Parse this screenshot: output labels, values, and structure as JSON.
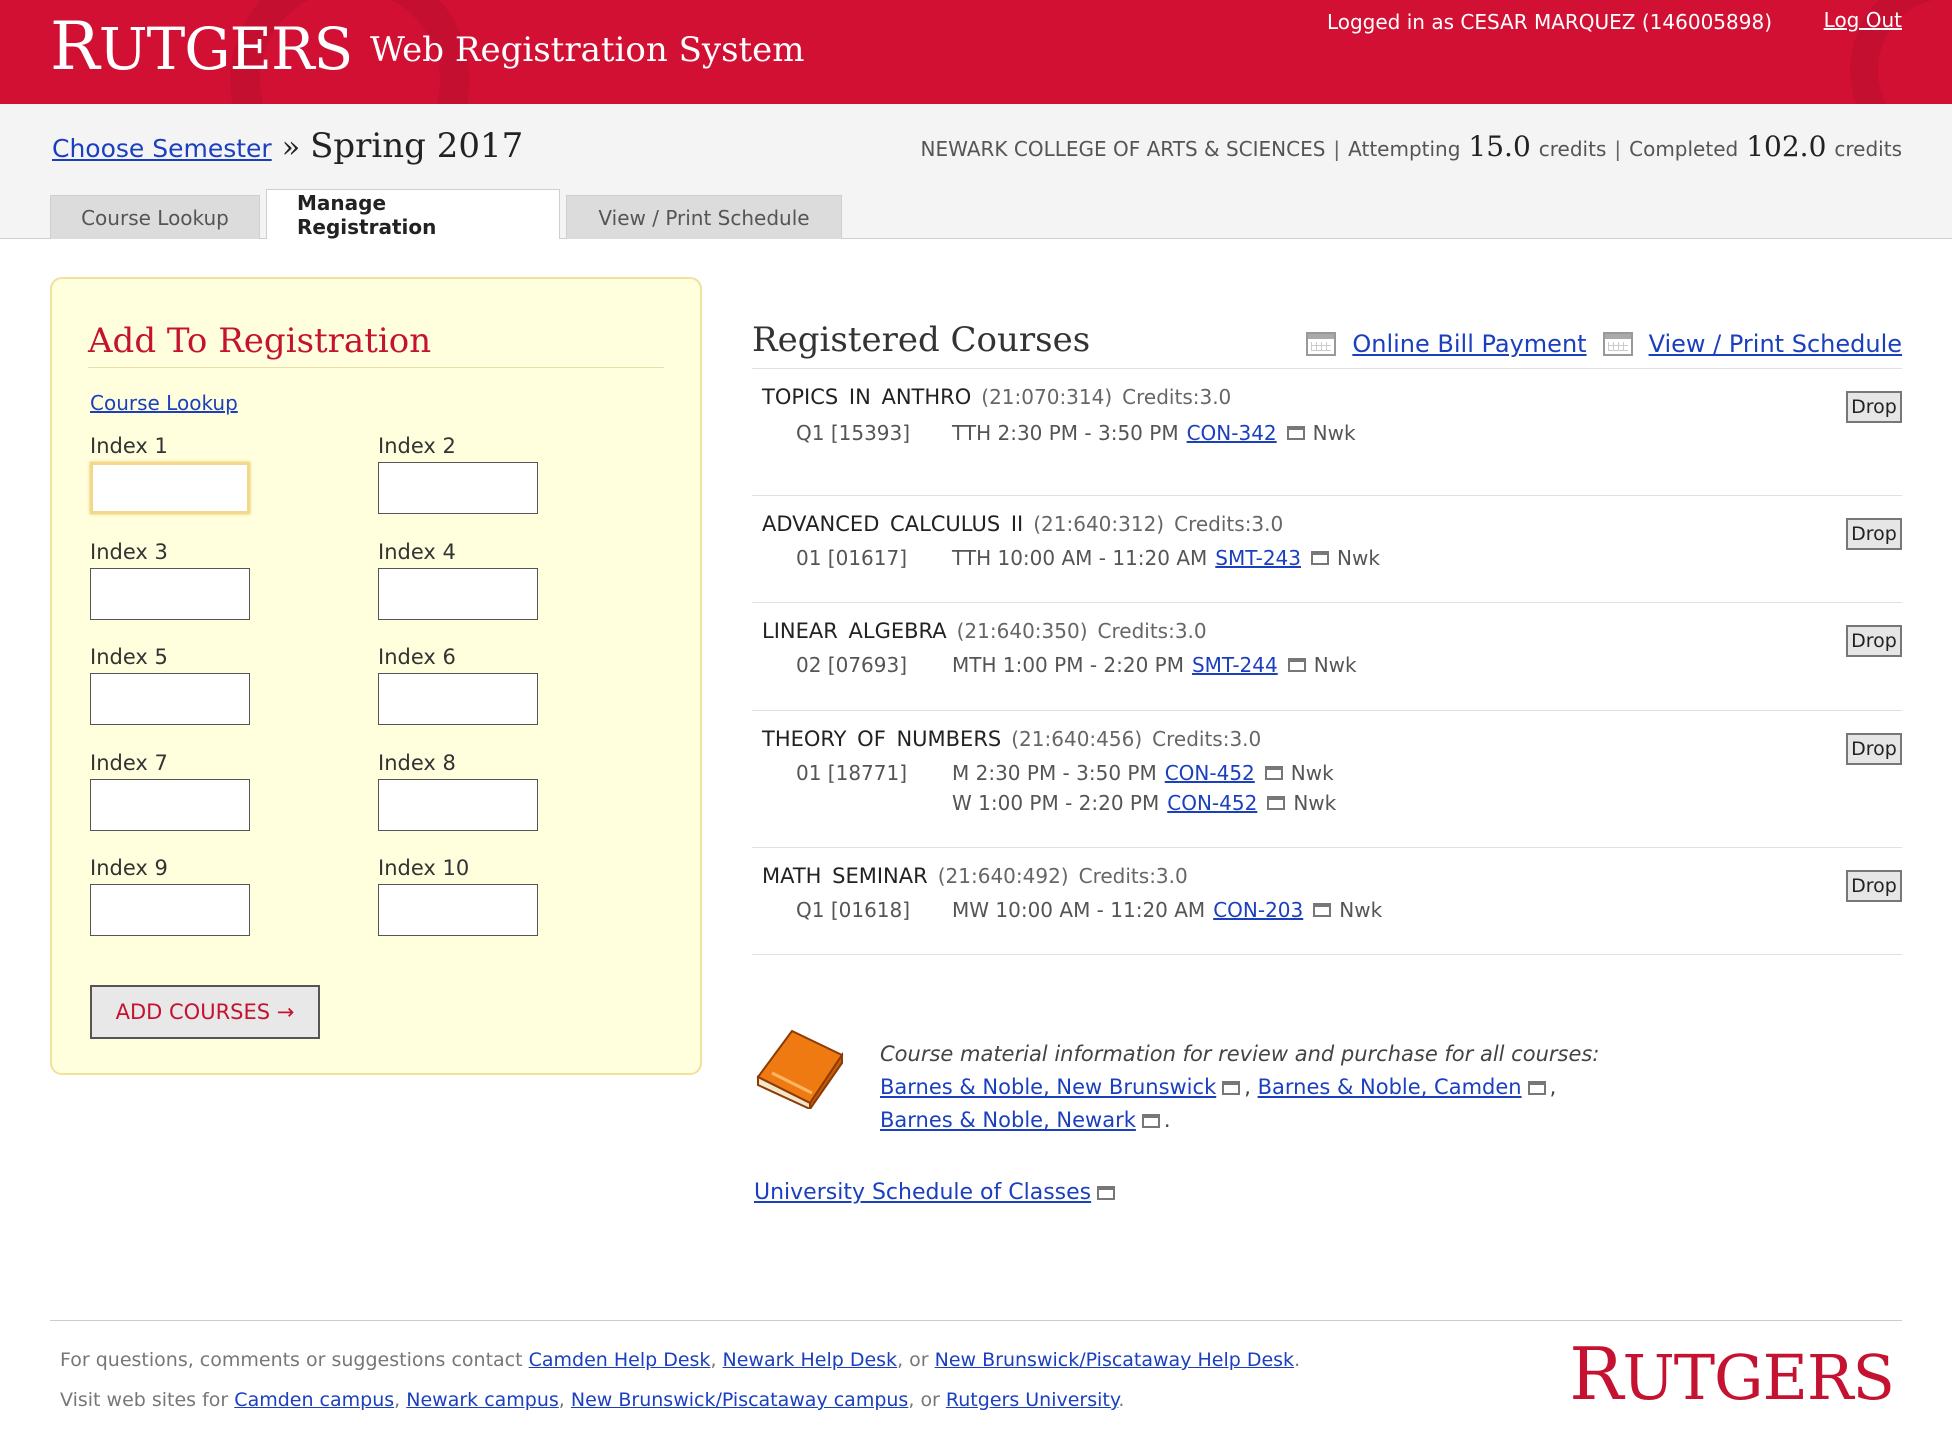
{
  "header": {
    "logo_first": "R",
    "logo_rest": "UTGERS",
    "app_title": "Web Registration System",
    "user_text": "Logged in as CESAR MARQUEZ (146005898)",
    "logout_label": "Log Out"
  },
  "subheader": {
    "choose_semester": "Choose Semester",
    "separator": "»",
    "semester": "Spring 2017",
    "college": "NEWARK COLLEGE OF ARTS & SCIENCES",
    "attempting_label": "Attempting",
    "attempting_value": "15.0",
    "completed_label": "Completed",
    "completed_value": "102.0",
    "credits_word": "credits",
    "pipe": "|"
  },
  "tabs": [
    {
      "label": "Course Lookup",
      "active": false
    },
    {
      "label": "Manage Registration",
      "active": true
    },
    {
      "label": "View / Print Schedule",
      "active": false
    }
  ],
  "add_panel": {
    "title": "Add To Registration",
    "lookup_link": "Course Lookup",
    "index_labels": [
      "Index 1",
      "Index 2",
      "Index 3",
      "Index 4",
      "Index 5",
      "Index 6",
      "Index 7",
      "Index 8",
      "Index 9",
      "Index 10"
    ],
    "index_values": [
      "",
      "",
      "",
      "",
      "",
      "",
      "",
      "",
      "",
      ""
    ],
    "button_label": "ADD COURSES →"
  },
  "registered": {
    "title": "Registered Courses",
    "bill_link": "Online Bill Payment",
    "schedule_link": "View / Print Schedule",
    "drop_label": "Drop",
    "courses": [
      {
        "name": "TOPICS IN ANTHRO",
        "code": "(21:070:314)",
        "credits": "Credits:3.0",
        "section": "Q1 [15393]",
        "meetings": [
          {
            "time": "TTH 2:30 PM - 3:50 PM",
            "room": "CON-342",
            "campus": "Nwk"
          }
        ]
      },
      {
        "name": "ADVANCED CALCULUS II",
        "code": "(21:640:312)",
        "credits": "Credits:3.0",
        "section": "01 [01617]",
        "meetings": [
          {
            "time": "TTH 10:00 AM - 11:20 AM",
            "room": "SMT-243",
            "campus": "Nwk"
          }
        ]
      },
      {
        "name": "LINEAR ALGEBRA",
        "code": "(21:640:350)",
        "credits": "Credits:3.0",
        "section": "02 [07693]",
        "meetings": [
          {
            "time": "MTH 1:00 PM - 2:20 PM",
            "room": "SMT-244",
            "campus": "Nwk"
          }
        ]
      },
      {
        "name": "THEORY OF NUMBERS",
        "code": "(21:640:456)",
        "credits": "Credits:3.0",
        "section": "01 [18771]",
        "meetings": [
          {
            "time": "M 2:30 PM - 3:50 PM",
            "room": "CON-452",
            "campus": "Nwk"
          },
          {
            "time": "W 1:00 PM - 2:20 PM",
            "room": "CON-452",
            "campus": "Nwk"
          }
        ]
      },
      {
        "name": "MATH SEMINAR",
        "code": "(21:640:492)",
        "credits": "Credits:3.0",
        "section": "Q1 [01618]",
        "meetings": [
          {
            "time": "MW 10:00 AM - 11:20 AM",
            "room": "CON-203",
            "campus": "Nwk"
          }
        ]
      }
    ]
  },
  "books": {
    "intro": "Course material information for review and purchase for all courses:",
    "bn_nb": "Barnes & Noble, New Brunswick",
    "bn_camden": "Barnes & Noble, Camden",
    "bn_newark": "Barnes & Noble, Newark",
    "comma": ",",
    "period": "."
  },
  "usoc_link": "University Schedule of Classes",
  "footer": {
    "line1_prefix": "For questions, comments or suggestions contact",
    "camden_help": "Camden Help Desk",
    "newark_help": "Newark Help Desk",
    "nb_help": "New Brunswick/Piscataway Help Desk",
    "line2_prefix": "Visit web sites for",
    "camden_campus": "Camden campus",
    "newark_campus": "Newark campus",
    "nb_campus": "New Brunswick/Piscataway campus",
    "rutgers_univ": "Rutgers University",
    "or_word": "or"
  },
  "colors": {
    "brand_red": "#d21034",
    "link_blue": "#1a3fbf",
    "panel_yellow": "#ffffdd"
  }
}
